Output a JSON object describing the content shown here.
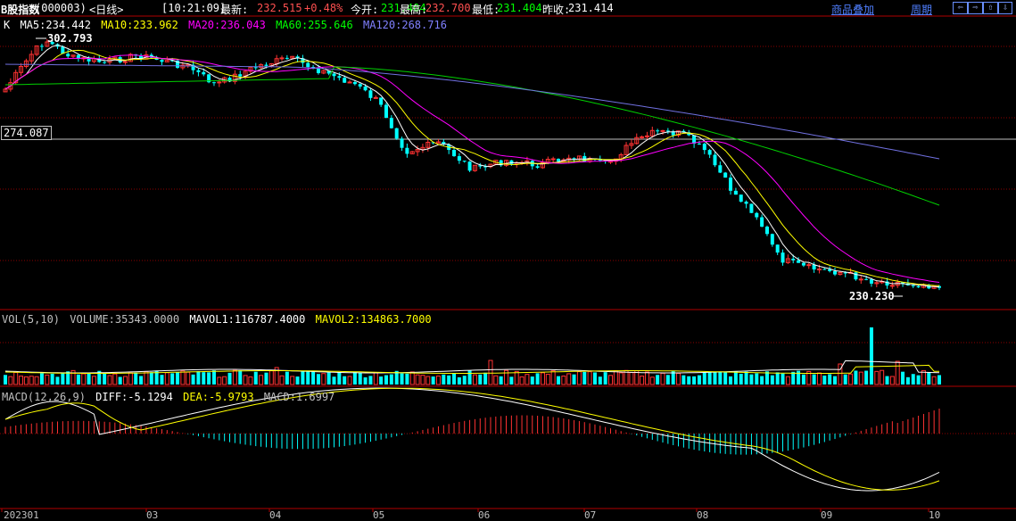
{
  "header": {
    "title": "B股指数",
    "code": "(000003)",
    "period_label": "<日线>",
    "time": "[10:21:09]",
    "latest_label": "最新:",
    "latest_value": "232.515",
    "change": "+0.48%",
    "open_label": "今开:",
    "open_value": "231.404",
    "high_label": "最高:",
    "high_value": "232.700",
    "low_label": "最低:",
    "low_value": "231.404",
    "prev_label": "昨收:",
    "prev_value": "231.414",
    "overlay_link": "商品叠加",
    "period_link": "周期",
    "nav_icons": [
      "arrow-left-icon",
      "arrow-right-icon",
      "arrow-up-icon",
      "arrow-down-icon"
    ]
  },
  "main_legend": {
    "prefix": "K",
    "ma5": "MA5:234.442",
    "ma10": "MA10:233.962",
    "ma20": "MA20:236.043",
    "ma60": "MA60:255.646",
    "ma120": "MA120:268.716",
    "colors": {
      "ma5": "#ffffff",
      "ma10": "#ffff00",
      "ma20": "#ff00ff",
      "ma60": "#00ff00",
      "ma120": "#8080ff"
    }
  },
  "price_labels": {
    "high_mark": "302.793",
    "low_mark": "230.230",
    "crosshair_value": "274.087"
  },
  "vol_legend": {
    "prefix": "VOL(5,10)",
    "volume": "VOLUME:35343.0000",
    "mavol1": "MAVOL1:116787.4000",
    "mavol2": "MAVOL2:134863.7000"
  },
  "macd_legend": {
    "prefix": "MACD(12,26,9)",
    "diff": "DIFF:-5.1294",
    "dea": "DEA:-5.9793",
    "macd": "MACD:1.6997"
  },
  "x_axis": [
    "202301",
    "03",
    "04",
    "05",
    "06",
    "07",
    "08",
    "09",
    "10"
  ],
  "colors": {
    "up": "#ff3232",
    "down": "#00ffff",
    "grid": "#8b0000",
    "crosshair": "#c0c0c0"
  }
}
